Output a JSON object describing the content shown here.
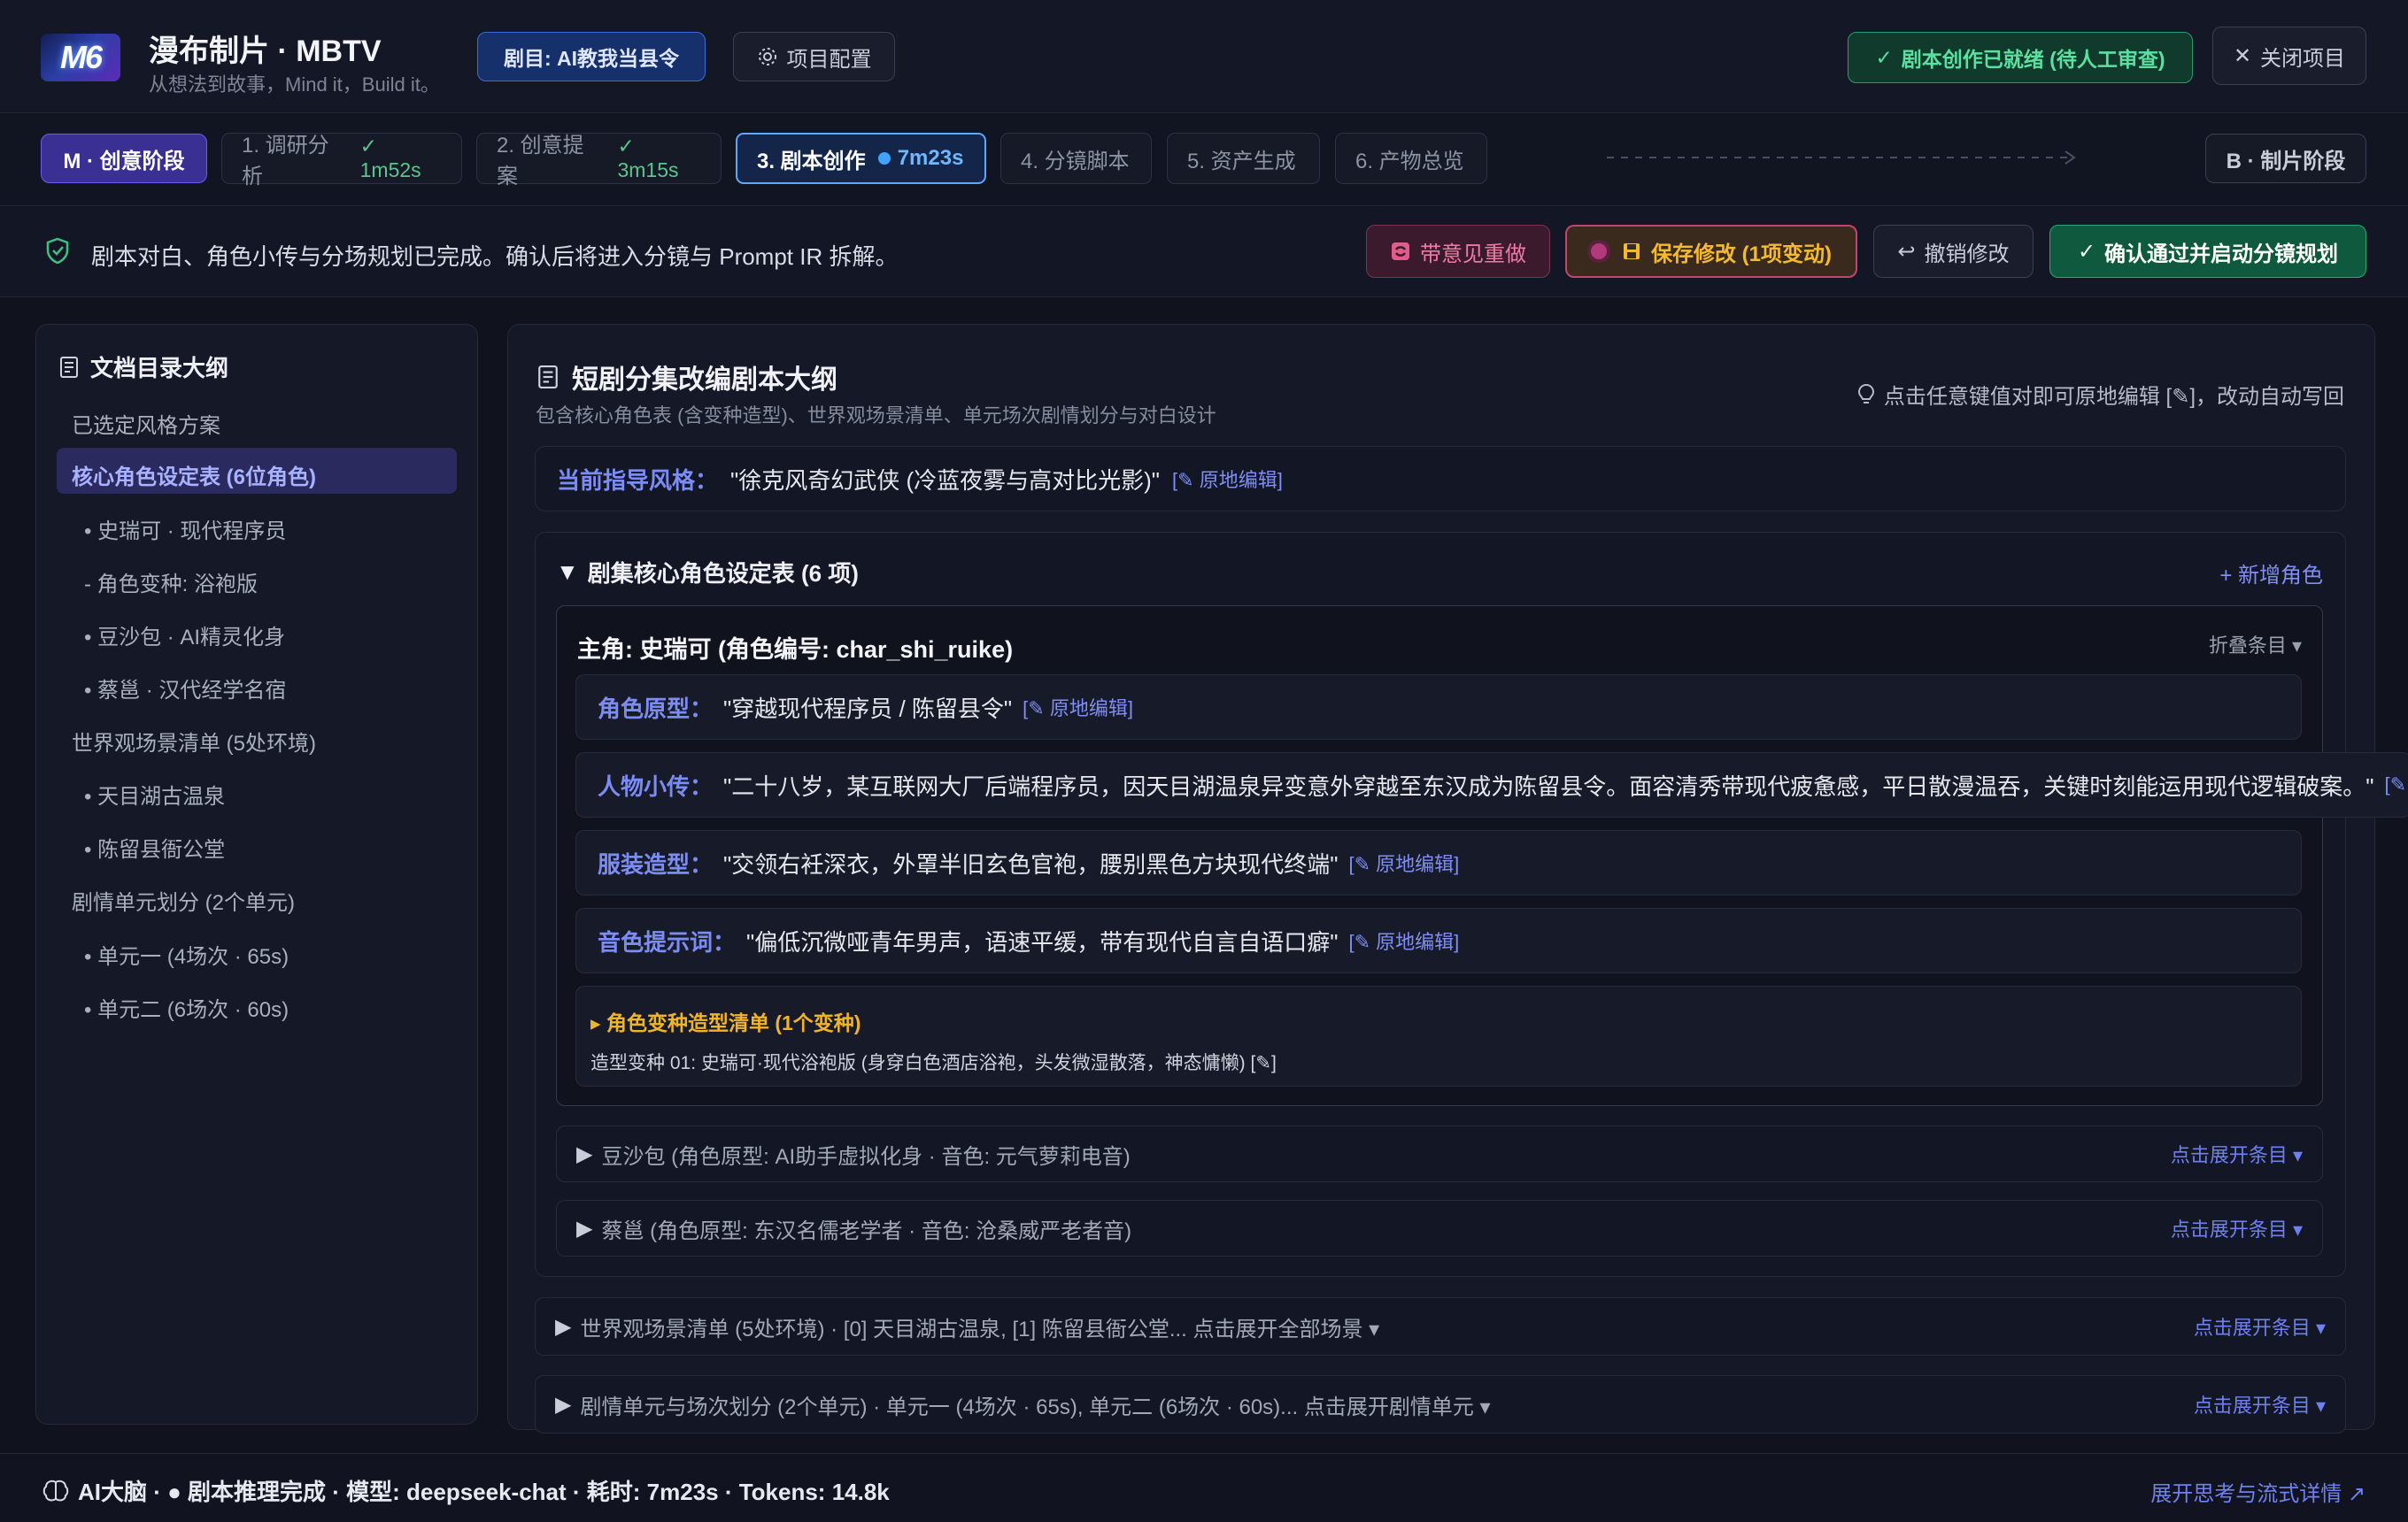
{
  "header": {
    "logo_text": "M6",
    "title": "漫布制片 · MBTV",
    "subtitle": "从想法到故事，Mind it，Build it。",
    "project_badge": "剧目: AI教我当县令",
    "config_button": "项目配置",
    "status_badge": "剧本创作已就绪 (待人工审查)",
    "close_button": "关闭项目"
  },
  "stages": {
    "m_stage": "M · 创意阶段",
    "b_stage": "B · 制片阶段",
    "steps": [
      {
        "label": "1. 调研分析",
        "time": "1m52s",
        "state": "done"
      },
      {
        "label": "2. 创意提案",
        "time": "3m15s",
        "state": "done"
      },
      {
        "label": "3. 剧本创作",
        "time": "7m23s",
        "state": "active"
      },
      {
        "label": "4. 分镜脚本",
        "time": "",
        "state": "pending"
      },
      {
        "label": "5. 资产生成",
        "time": "",
        "state": "pending"
      },
      {
        "label": "6. 产物总览",
        "time": "",
        "state": "pending"
      }
    ]
  },
  "notice": {
    "text": "剧本对白、角色小传与分场规划已完成。确认后将进入分镜与 Prompt IR 拆解。",
    "redo_button": "带意见重做",
    "save_button": "保存修改 (1项变动)",
    "undo_button": "撤销修改",
    "confirm_button": "确认通过并启动分镜规划"
  },
  "sidebar": {
    "title": "文档目录大纲",
    "items": [
      {
        "label": "已选定风格方案"
      },
      {
        "label": "核心角色设定表 (6位角色)"
      },
      {
        "label": "• 史瑞可 · 现代程序员"
      },
      {
        "label": "- 角色变种: 浴袍版"
      },
      {
        "label": "• 豆沙包 · AI精灵化身"
      },
      {
        "label": "• 蔡邕 · 汉代经学名宿"
      },
      {
        "label": "世界观场景清单 (5处环境)"
      },
      {
        "label": "• 天目湖古温泉"
      },
      {
        "label": "• 陈留县衙公堂"
      },
      {
        "label": "剧情单元划分 (2个单元)"
      },
      {
        "label": "• 单元一 (4场次 · 65s)"
      },
      {
        "label": "• 单元二 (6场次 · 60s)"
      }
    ]
  },
  "main": {
    "title": "短剧分集改编剧本大纲",
    "description": "包含核心角色表 (含变种造型)、世界观场景清单、单元场次剧情划分与对白设计",
    "hint": "点击任意键值对即可原地编辑 [✎]，改动自动写回",
    "style_label": "当前指导风格：",
    "style_value": "\"徐克风奇幻武侠 (冷蓝夜雾与高对比光影)\"",
    "edit_tag": "原地编辑]",
    "roles_section_title": "剧集核心角色设定表 (6 项)",
    "add_role": "+ 新增角色",
    "protagonist": {
      "header": "主角: 史瑞可 (角色编号: char_shi_ruike)",
      "collapse": "折叠条目",
      "fields": [
        {
          "label": "角色原型：",
          "value": "\"穿越现代程序员 / 陈留县令\""
        },
        {
          "label": "人物小传：",
          "value": "\"二十八岁，某互联网大厂后端程序员，因天目湖温泉异变意外穿越至东汉成为陈留县令。面容清秀带现代疲惫感，平日散漫温吞，关键时刻能运用现代逻辑破案。\""
        },
        {
          "label": "服装造型：",
          "value": "\"交领右衽深衣，外罩半旧玄色官袍，腰别黑色方块现代终端\""
        },
        {
          "label": "音色提示词：",
          "value": "\"偏低沉微哑青年男声，语速平缓，带有现代自言自语口癖\""
        }
      ],
      "variants_title": "角色变种造型清单 (1个变种)",
      "variant_line": "造型变种 01: 史瑞可·现代浴袍版 (身穿白色酒店浴袍，头发微湿散落，神态慵懒) [✎]"
    },
    "collapsed_roles": [
      "豆沙包 (角色原型: AI助手虚拟化身 · 音色: 元气萝莉电音)",
      "蔡邕 (角色原型: 东汉名儒老学者 · 音色: 沧桑威严老者音)"
    ],
    "expand_item": "点击展开条目",
    "scenes_row": "世界观场景清单 (5处环境) · [0] 天目湖古温泉, [1] 陈留县衙公堂... 点击展开全部场景",
    "units_row": "剧情单元与场次划分 (2个单元) · 单元一 (4场次 · 65s), 单元二 (6场次 · 60s)... 点击展开剧情单元"
  },
  "footer": {
    "status": "AI大脑 · ● 剧本推理完成 · 模型: deepseek-chat · 耗时: 7m23s · Tokens: 14.8k",
    "link": "展开思考与流式详情"
  },
  "colors": {
    "accent": "#6d7bf5",
    "success": "#3fbf80",
    "warning": "#f0b429",
    "danger": "#e05c8a"
  }
}
